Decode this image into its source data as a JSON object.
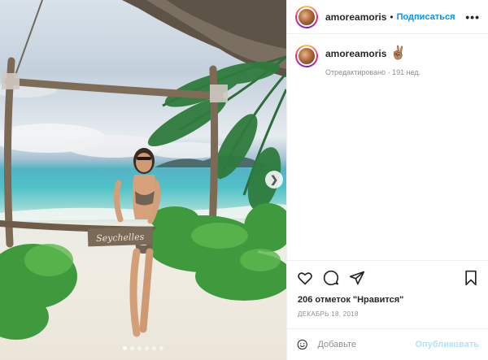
{
  "post": {
    "username": "amoreamoris",
    "follow_label": "Подписаться",
    "more_label": "•••",
    "caption_user": "amoreamoris",
    "caption_emoji": "✌🏽",
    "edited_label": "Отредактировано",
    "time_ago": "191 нед.",
    "likes": "206 отметок \"Нравится\"",
    "date": "ДЕКАБРЬ 18, 2018"
  },
  "photo": {
    "sign_text": "Seychelles",
    "slides": 6,
    "active_slide": 1
  },
  "comment": {
    "placeholder": "Добавьте",
    "publish_label": "Опубликовать"
  },
  "icons": {
    "like": "heart-icon",
    "comment": "comment-icon",
    "share": "paper-plane-icon",
    "save": "bookmark-icon",
    "emoji": "smile-icon",
    "next": "chevron-right-icon"
  },
  "colors": {
    "accent": "#0095f6",
    "publish_disabled": "#b2dffc",
    "secondary_text": "#8e8e8e"
  }
}
